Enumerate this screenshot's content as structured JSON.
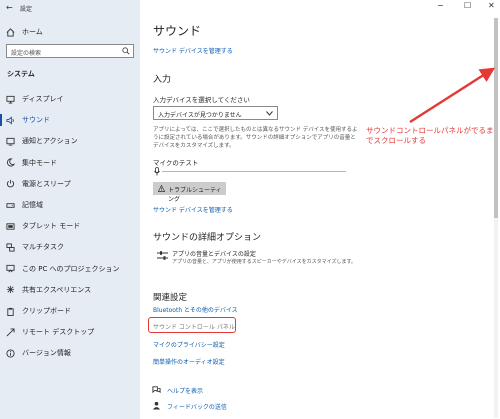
{
  "window": {
    "title": "設定",
    "controls": {
      "minimize": "−",
      "maximize": "☐",
      "close": "✕"
    }
  },
  "sidebar": {
    "back_glyph": "←",
    "home_label": "ホーム",
    "search_placeholder": "設定の検索",
    "section_title": "システム",
    "items": [
      {
        "label": "ディスプレイ",
        "icon": "display-icon"
      },
      {
        "label": "サウンド",
        "icon": "speaker-icon",
        "active": true
      },
      {
        "label": "通知とアクション",
        "icon": "notification-icon"
      },
      {
        "label": "集中モード",
        "icon": "moon-icon"
      },
      {
        "label": "電源とスリープ",
        "icon": "power-icon"
      },
      {
        "label": "記憶域",
        "icon": "storage-icon"
      },
      {
        "label": "タブレット モード",
        "icon": "tablet-icon"
      },
      {
        "label": "マルチタスク",
        "icon": "multitask-icon"
      },
      {
        "label": "この PC へのプロジェクション",
        "icon": "projection-icon"
      },
      {
        "label": "共有エクスペリエンス",
        "icon": "shared-icon"
      },
      {
        "label": "クリップボード",
        "icon": "clipboard-icon"
      },
      {
        "label": "リモート デスクトップ",
        "icon": "remote-icon"
      },
      {
        "label": "バージョン情報",
        "icon": "info-icon"
      }
    ]
  },
  "main": {
    "title": "サウンド",
    "manage_devices_link": "サウンド デバイスを管理する",
    "input": {
      "heading": "入力",
      "select_label": "入力デバイスを選択してください",
      "select_value": "入力デバイスが見つかりません",
      "description": "アプリによっては、ここで選択したものとは異なるサウンド デバイスを使用するように設定されている場合があります。サウンドの詳細オプションでアプリの音量とデバイスをカスタマイズします。",
      "mic_test_label": "マイクのテスト",
      "troubleshoot_button": "トラブルシューティング",
      "manage_devices_link": "サウンド デバイスを管理する"
    },
    "advanced": {
      "heading": "サウンドの詳細オプション",
      "app_volume_title": "アプリの音量とデバイスの設定",
      "app_volume_desc": "アプリの音量と、アプリが使用するスピーカーやデバイスをカスタマイズします。"
    },
    "related": {
      "heading": "関連設定",
      "links": [
        "Bluetooth とその他のデバイス",
        "サウンド コントロール パネル",
        "マイクのプライバシー設定",
        "簡単操作のオーディオ設定"
      ]
    },
    "help": {
      "get_help": "ヘルプを表示",
      "feedback": "フィードバックの送信"
    }
  },
  "annotation": {
    "text": "サウンドコントロールパネルがでるまでスクロールする",
    "color": "#e53935"
  },
  "colors": {
    "accent": "#0b5cad",
    "sidebar_bg": "#e6ecf4",
    "highlight_box": "#e53935"
  }
}
